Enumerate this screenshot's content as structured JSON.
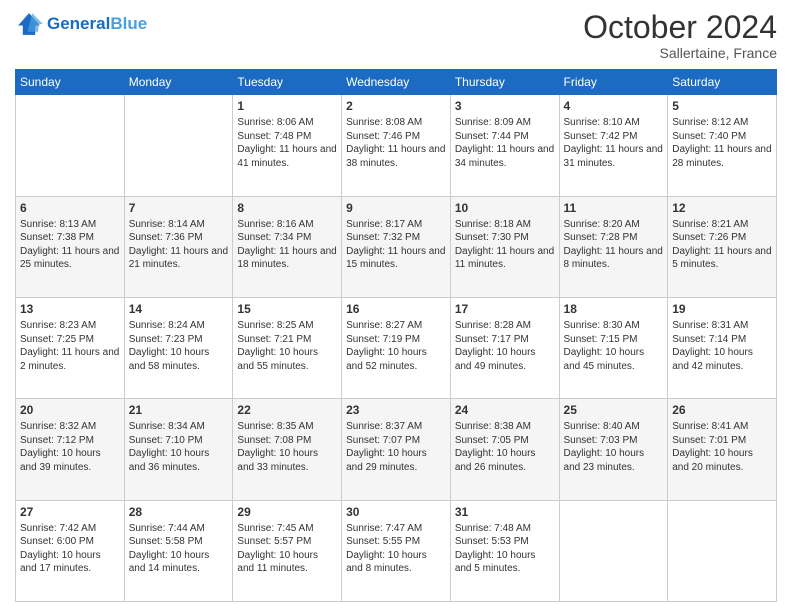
{
  "header": {
    "logo_line1": "General",
    "logo_line2": "Blue",
    "month_title": "October 2024",
    "location": "Sallertaine, France"
  },
  "days_of_week": [
    "Sunday",
    "Monday",
    "Tuesday",
    "Wednesday",
    "Thursday",
    "Friday",
    "Saturday"
  ],
  "weeks": [
    [
      {
        "day": "",
        "sunrise": "",
        "sunset": "",
        "daylight": ""
      },
      {
        "day": "",
        "sunrise": "",
        "sunset": "",
        "daylight": ""
      },
      {
        "day": "1",
        "sunrise": "Sunrise: 8:06 AM",
        "sunset": "Sunset: 7:48 PM",
        "daylight": "Daylight: 11 hours and 41 minutes."
      },
      {
        "day": "2",
        "sunrise": "Sunrise: 8:08 AM",
        "sunset": "Sunset: 7:46 PM",
        "daylight": "Daylight: 11 hours and 38 minutes."
      },
      {
        "day": "3",
        "sunrise": "Sunrise: 8:09 AM",
        "sunset": "Sunset: 7:44 PM",
        "daylight": "Daylight: 11 hours and 34 minutes."
      },
      {
        "day": "4",
        "sunrise": "Sunrise: 8:10 AM",
        "sunset": "Sunset: 7:42 PM",
        "daylight": "Daylight: 11 hours and 31 minutes."
      },
      {
        "day": "5",
        "sunrise": "Sunrise: 8:12 AM",
        "sunset": "Sunset: 7:40 PM",
        "daylight": "Daylight: 11 hours and 28 minutes."
      }
    ],
    [
      {
        "day": "6",
        "sunrise": "Sunrise: 8:13 AM",
        "sunset": "Sunset: 7:38 PM",
        "daylight": "Daylight: 11 hours and 25 minutes."
      },
      {
        "day": "7",
        "sunrise": "Sunrise: 8:14 AM",
        "sunset": "Sunset: 7:36 PM",
        "daylight": "Daylight: 11 hours and 21 minutes."
      },
      {
        "day": "8",
        "sunrise": "Sunrise: 8:16 AM",
        "sunset": "Sunset: 7:34 PM",
        "daylight": "Daylight: 11 hours and 18 minutes."
      },
      {
        "day": "9",
        "sunrise": "Sunrise: 8:17 AM",
        "sunset": "Sunset: 7:32 PM",
        "daylight": "Daylight: 11 hours and 15 minutes."
      },
      {
        "day": "10",
        "sunrise": "Sunrise: 8:18 AM",
        "sunset": "Sunset: 7:30 PM",
        "daylight": "Daylight: 11 hours and 11 minutes."
      },
      {
        "day": "11",
        "sunrise": "Sunrise: 8:20 AM",
        "sunset": "Sunset: 7:28 PM",
        "daylight": "Daylight: 11 hours and 8 minutes."
      },
      {
        "day": "12",
        "sunrise": "Sunrise: 8:21 AM",
        "sunset": "Sunset: 7:26 PM",
        "daylight": "Daylight: 11 hours and 5 minutes."
      }
    ],
    [
      {
        "day": "13",
        "sunrise": "Sunrise: 8:23 AM",
        "sunset": "Sunset: 7:25 PM",
        "daylight": "Daylight: 11 hours and 2 minutes."
      },
      {
        "day": "14",
        "sunrise": "Sunrise: 8:24 AM",
        "sunset": "Sunset: 7:23 PM",
        "daylight": "Daylight: 10 hours and 58 minutes."
      },
      {
        "day": "15",
        "sunrise": "Sunrise: 8:25 AM",
        "sunset": "Sunset: 7:21 PM",
        "daylight": "Daylight: 10 hours and 55 minutes."
      },
      {
        "day": "16",
        "sunrise": "Sunrise: 8:27 AM",
        "sunset": "Sunset: 7:19 PM",
        "daylight": "Daylight: 10 hours and 52 minutes."
      },
      {
        "day": "17",
        "sunrise": "Sunrise: 8:28 AM",
        "sunset": "Sunset: 7:17 PM",
        "daylight": "Daylight: 10 hours and 49 minutes."
      },
      {
        "day": "18",
        "sunrise": "Sunrise: 8:30 AM",
        "sunset": "Sunset: 7:15 PM",
        "daylight": "Daylight: 10 hours and 45 minutes."
      },
      {
        "day": "19",
        "sunrise": "Sunrise: 8:31 AM",
        "sunset": "Sunset: 7:14 PM",
        "daylight": "Daylight: 10 hours and 42 minutes."
      }
    ],
    [
      {
        "day": "20",
        "sunrise": "Sunrise: 8:32 AM",
        "sunset": "Sunset: 7:12 PM",
        "daylight": "Daylight: 10 hours and 39 minutes."
      },
      {
        "day": "21",
        "sunrise": "Sunrise: 8:34 AM",
        "sunset": "Sunset: 7:10 PM",
        "daylight": "Daylight: 10 hours and 36 minutes."
      },
      {
        "day": "22",
        "sunrise": "Sunrise: 8:35 AM",
        "sunset": "Sunset: 7:08 PM",
        "daylight": "Daylight: 10 hours and 33 minutes."
      },
      {
        "day": "23",
        "sunrise": "Sunrise: 8:37 AM",
        "sunset": "Sunset: 7:07 PM",
        "daylight": "Daylight: 10 hours and 29 minutes."
      },
      {
        "day": "24",
        "sunrise": "Sunrise: 8:38 AM",
        "sunset": "Sunset: 7:05 PM",
        "daylight": "Daylight: 10 hours and 26 minutes."
      },
      {
        "day": "25",
        "sunrise": "Sunrise: 8:40 AM",
        "sunset": "Sunset: 7:03 PM",
        "daylight": "Daylight: 10 hours and 23 minutes."
      },
      {
        "day": "26",
        "sunrise": "Sunrise: 8:41 AM",
        "sunset": "Sunset: 7:01 PM",
        "daylight": "Daylight: 10 hours and 20 minutes."
      }
    ],
    [
      {
        "day": "27",
        "sunrise": "Sunrise: 7:42 AM",
        "sunset": "Sunset: 6:00 PM",
        "daylight": "Daylight: 10 hours and 17 minutes."
      },
      {
        "day": "28",
        "sunrise": "Sunrise: 7:44 AM",
        "sunset": "Sunset: 5:58 PM",
        "daylight": "Daylight: 10 hours and 14 minutes."
      },
      {
        "day": "29",
        "sunrise": "Sunrise: 7:45 AM",
        "sunset": "Sunset: 5:57 PM",
        "daylight": "Daylight: 10 hours and 11 minutes."
      },
      {
        "day": "30",
        "sunrise": "Sunrise: 7:47 AM",
        "sunset": "Sunset: 5:55 PM",
        "daylight": "Daylight: 10 hours and 8 minutes."
      },
      {
        "day": "31",
        "sunrise": "Sunrise: 7:48 AM",
        "sunset": "Sunset: 5:53 PM",
        "daylight": "Daylight: 10 hours and 5 minutes."
      },
      {
        "day": "",
        "sunrise": "",
        "sunset": "",
        "daylight": ""
      },
      {
        "day": "",
        "sunrise": "",
        "sunset": "",
        "daylight": ""
      }
    ]
  ]
}
